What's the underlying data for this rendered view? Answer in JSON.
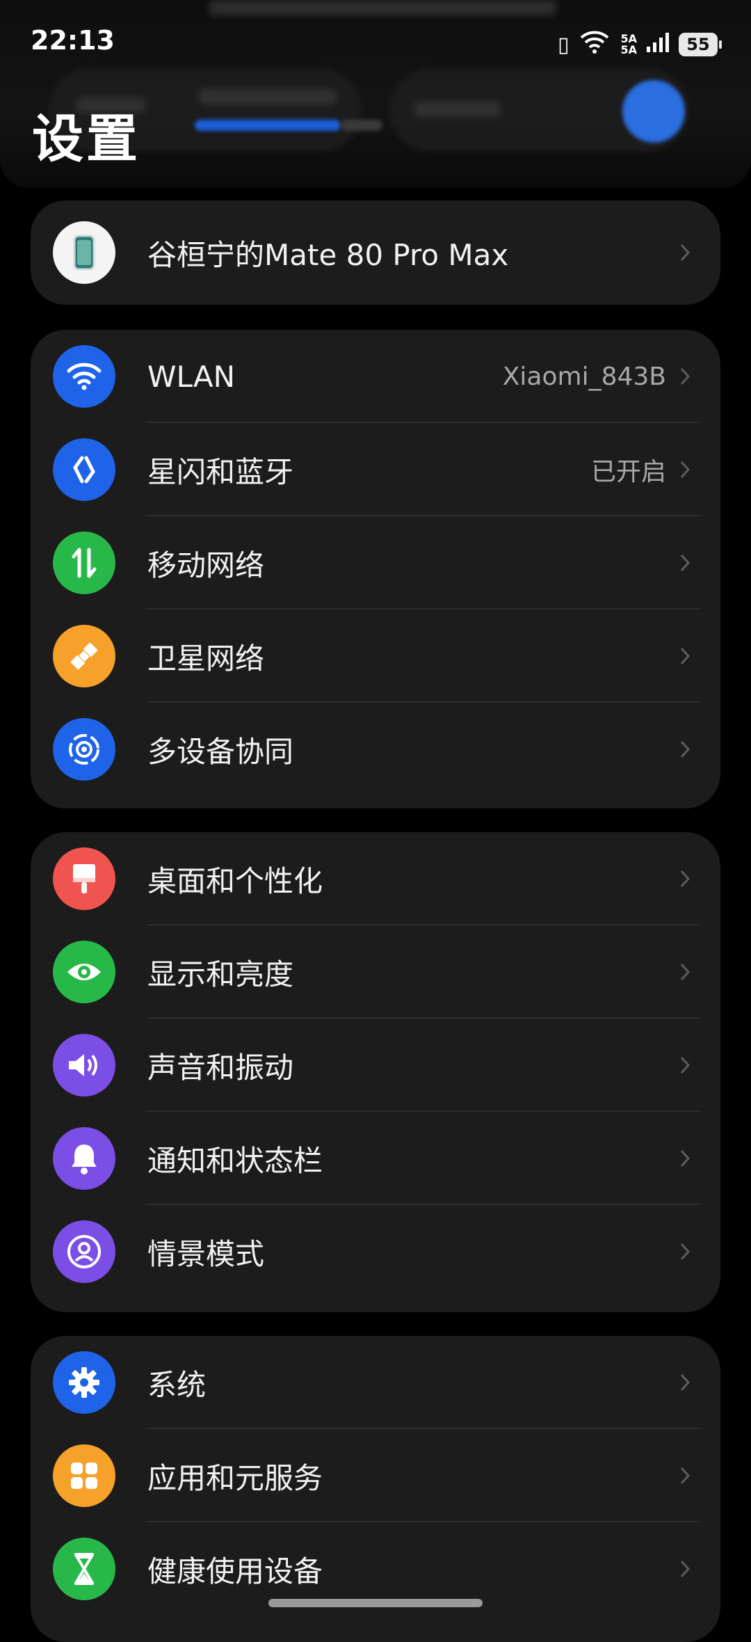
{
  "status": {
    "time": "22:13",
    "network_icon": "6",
    "signal_label_top": "5A",
    "signal_label_bottom": "5A",
    "battery": "55"
  },
  "page": {
    "title": "设置"
  },
  "groups": [
    {
      "items": [
        {
          "label": "谷桓宁的Mate 80 Pro Max",
          "icon": "phone-icon",
          "color": "#ffffff"
        }
      ]
    },
    {
      "items": [
        {
          "label": "WLAN",
          "value": "Xiaomi_843B",
          "icon": "wifi-icon",
          "color": "#1f63e9"
        },
        {
          "label": "星闪和蓝牙",
          "value": "已开启",
          "icon": "bluetooth-icon",
          "color": "#1f63e9"
        },
        {
          "label": "移动网络",
          "value": "",
          "icon": "mobile-data-icon",
          "color": "#28b84a"
        },
        {
          "label": "卫星网络",
          "value": "",
          "icon": "satellite-icon",
          "color": "#f6a12a"
        },
        {
          "label": "多设备协同",
          "value": "",
          "icon": "multi-device-icon",
          "color": "#1f63e9"
        }
      ]
    },
    {
      "items": [
        {
          "label": "桌面和个性化",
          "icon": "brush-icon",
          "color": "#f0544f"
        },
        {
          "label": "显示和亮度",
          "icon": "eye-icon",
          "color": "#28b84a"
        },
        {
          "label": "声音和振动",
          "icon": "speaker-icon",
          "color": "#7b4ee6"
        },
        {
          "label": "通知和状态栏",
          "icon": "bell-icon",
          "color": "#7b4ee6"
        },
        {
          "label": "情景模式",
          "icon": "profile-mode-icon",
          "color": "#7b4ee6"
        }
      ]
    },
    {
      "items": [
        {
          "label": "系统",
          "icon": "gear-icon",
          "color": "#1f63e9"
        },
        {
          "label": "应用和元服务",
          "icon": "apps-icon",
          "color": "#f6a12a"
        },
        {
          "label": "健康使用设备",
          "icon": "hourglass-icon",
          "color": "#28b84a"
        }
      ]
    }
  ]
}
